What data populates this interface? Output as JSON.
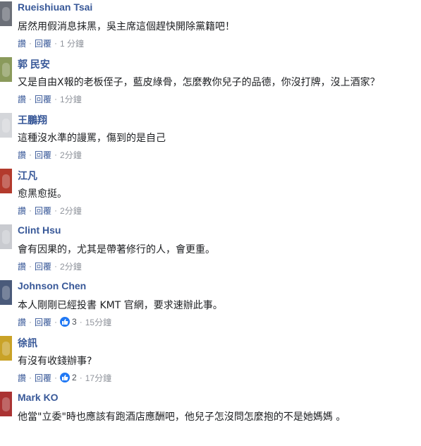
{
  "ui": {
    "dot": "·"
  },
  "comments": [
    {
      "name": "Rueishiuan Tsai",
      "text": "居然用假消息抹黑，吳主席這個趕快開除黨籍吧！",
      "like": "讚",
      "reply": "回覆",
      "time": "1 分鐘",
      "reactions": null,
      "avatar_color": "#6b6f78"
    },
    {
      "name": "郭 民安",
      "text": "又是自由X報的老板侄子，藍皮綠骨，怎麼教你兒子的品德，你沒打牌，沒上酒家？",
      "like": "讚",
      "reply": "回覆",
      "time": "1分鐘",
      "reactions": null,
      "avatar_color": "#8a9a5b"
    },
    {
      "name": "王鵬翔",
      "text": "這種沒水準的謾罵，傷到的是自己",
      "like": "讚",
      "reply": "回覆",
      "time": "2分鐘",
      "reactions": null,
      "avatar_color": "#d4d6da"
    },
    {
      "name": "江凡",
      "text": "愈黑愈挺。",
      "like": "讚",
      "reply": "回覆",
      "time": "2分鐘",
      "reactions": null,
      "avatar_color": "#b33a2c"
    },
    {
      "name": "Clint Hsu",
      "text": "會有因果的，尤其是帶著修行的人，會更重。",
      "like": "讚",
      "reply": "回覆",
      "time": "2分鐘",
      "reactions": null,
      "avatar_color": "#c9cbd0"
    },
    {
      "name": "Johnson Chen",
      "text": "本人剛剛已經投書 KMT 官網，要求速辦此事。",
      "like": "讚",
      "reply": "回覆",
      "time": "15分鐘",
      "reactions": "3",
      "avatar_color": "#4a5a7a"
    },
    {
      "name": "徐訊",
      "text": "有沒有收錢辦事?",
      "like": "讚",
      "reply": "回覆",
      "time": "17分鐘",
      "reactions": "2",
      "avatar_color": "#c9a227"
    },
    {
      "name": "Mark KO",
      "text": "他當\"立委\"時也應該有跑酒店應酬吧，他兒子怎沒問怎麼抱的不是她媽媽 。",
      "like": "讚",
      "reply": "回覆",
      "time": "",
      "reactions": null,
      "avatar_color": "#a33"
    }
  ]
}
